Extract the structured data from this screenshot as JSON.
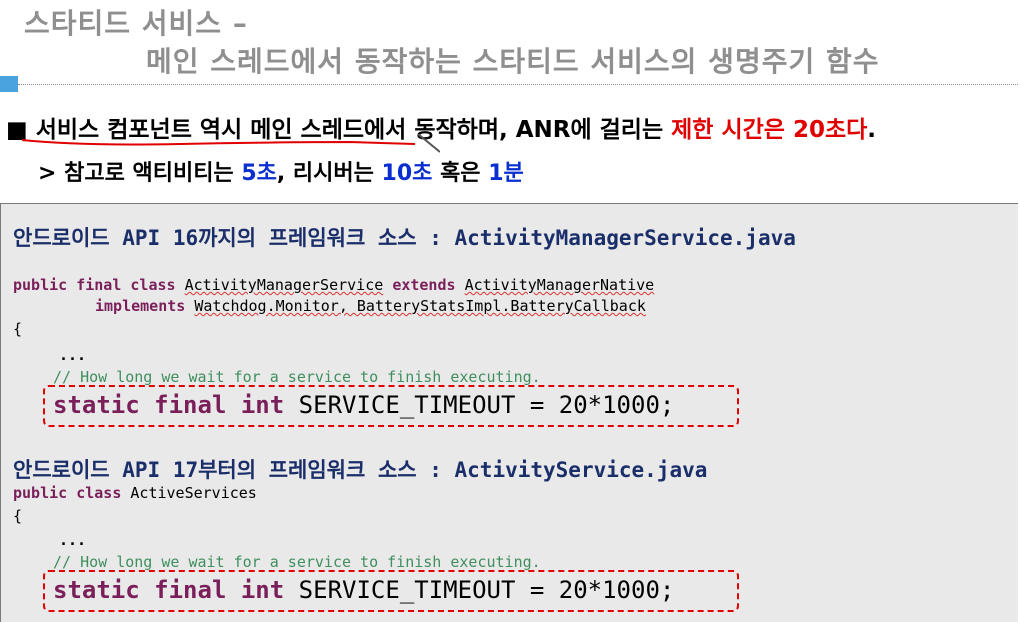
{
  "title": {
    "line1": "스타티드 서비스 –",
    "line2": "메인 스레드에서 동작하는 스타티드 서비스의 생명주기 함수"
  },
  "bullet": {
    "marker": "■",
    "text_a": " 서비스 컴포넌트 역시 메인 스레드에서 동작하며, ANR에 걸리는 ",
    "text_red": "제한 시간은 20초다",
    "text_end": "."
  },
  "sub": {
    "prefix": "> 참고로 액티비티는 ",
    "val1": "5초",
    "mid": ", 리시버는 ",
    "val2": "10초",
    "mid2": " 혹은 ",
    "val3": "1분"
  },
  "section1": {
    "heading": "안드로이드 API 16까지의 프레임워크 소스 : ActivityManagerService.java",
    "kw_public": "public",
    "kw_final": "final",
    "kw_class": "class",
    "class_name": "ActivityManagerService",
    "kw_extends": "extends",
    "parent": "ActivityManagerNative",
    "kw_implements": "implements",
    "interfaces": "Watchdog.Monitor, BatteryStatsImpl.BatteryCallback",
    "brace": "{",
    "dots": "...",
    "comment": "// How long we wait for a service to finish executing.",
    "kw_static": "static",
    "kw_final2": "final",
    "kw_int": "int",
    "constant": "SERVICE_TIMEOUT = 20*1000;"
  },
  "section2": {
    "heading": "안드로이드 API 17부터의 프레임워크 소스 : ActivityService.java",
    "kw_public": "public",
    "kw_class": "class",
    "class_name": "ActiveServices",
    "brace": "{",
    "dots": "...",
    "comment": "// How long we wait for a service to finish executing.",
    "kw_static": "static",
    "kw_final": "final",
    "kw_int": "int",
    "constant": "SERVICE_TIMEOUT = 20*1000;"
  },
  "colors": {
    "accent_red": "#e00000",
    "accent_blue": "#0a2fd0",
    "keyword": "#7a1f5a",
    "comment": "#3f8f5f"
  }
}
